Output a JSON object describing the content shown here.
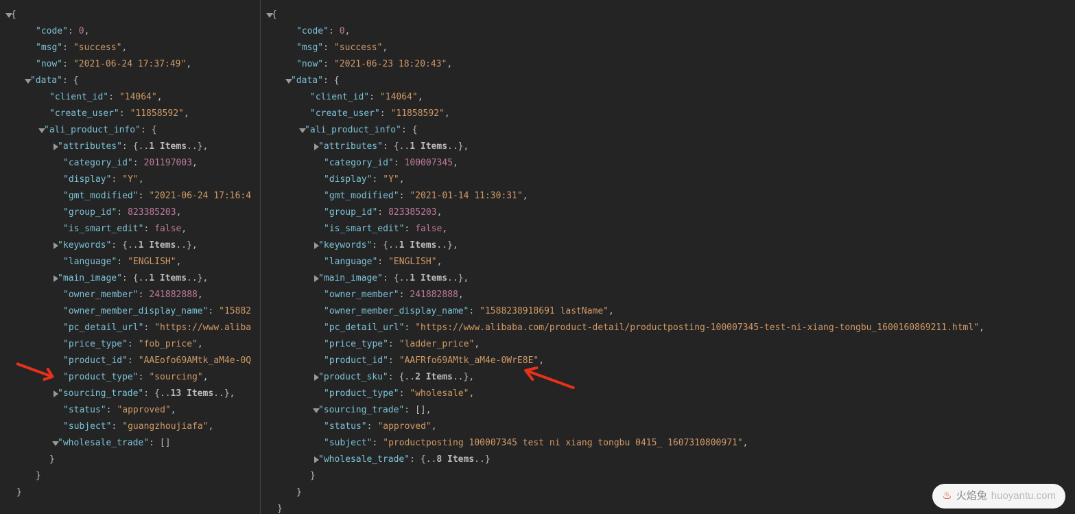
{
  "left": {
    "code": "0",
    "msg": "\"success\"",
    "now": "\"2021-06-24 17:37:49\"",
    "client_id": "\"14064\"",
    "create_user": "\"11858592\"",
    "attributes_items": "1",
    "category_id": "201197003",
    "display": "\"Y\"",
    "gmt_modified": "\"2021-06-24 17:16:4",
    "group_id": "823385203",
    "is_smart_edit": "false",
    "keywords_items": "1",
    "language": "\"ENGLISH\"",
    "main_image_items": "1",
    "owner_member": "241882888",
    "owner_member_display_name": "\"15882",
    "pc_detail_url": "\"https://www.aliba",
    "price_type": "\"fob_price\"",
    "product_id": "\"AAEofo69AMtk_aM4e-0Q",
    "product_type": "\"sourcing\"",
    "sourcing_trade_items": "13",
    "status": "\"approved\"",
    "subject": "\"guangzhoujiafa\"",
    "wholesale_trade": "[]"
  },
  "right": {
    "code": "0",
    "msg": "\"success\"",
    "now": "\"2021-06-23 18:20:43\"",
    "client_id": "\"14064\"",
    "create_user": "\"11858592\"",
    "attributes_items": "1",
    "category_id": "100007345",
    "display": "\"Y\"",
    "gmt_modified": "\"2021-01-14 11:30:31\"",
    "group_id": "823385203",
    "is_smart_edit": "false",
    "keywords_items": "1",
    "language": "\"ENGLISH\"",
    "main_image_items": "1",
    "owner_member": "241882888",
    "owner_member_display_name": "\"1588238918691 lastName\"",
    "pc_detail_url": "\"https://www.alibaba.com/product-detail/productposting-100007345-test-ni-xiang-tongbu_1600160869211.html\"",
    "price_type": "\"ladder_price\"",
    "product_id": "\"AAFRfo69AMtk_aM4e-0WrE8E\"",
    "product_sku_items": "2",
    "product_type": "\"wholesale\"",
    "sourcing_trade": "[]",
    "status": "\"approved\"",
    "subject": "\"productposting 100007345 test ni xiang tongbu 0415_ 1607310800971\"",
    "wholesale_trade_items": "8"
  },
  "watermark": {
    "cn": "火焰兔",
    "en": "huoyantu.com"
  }
}
